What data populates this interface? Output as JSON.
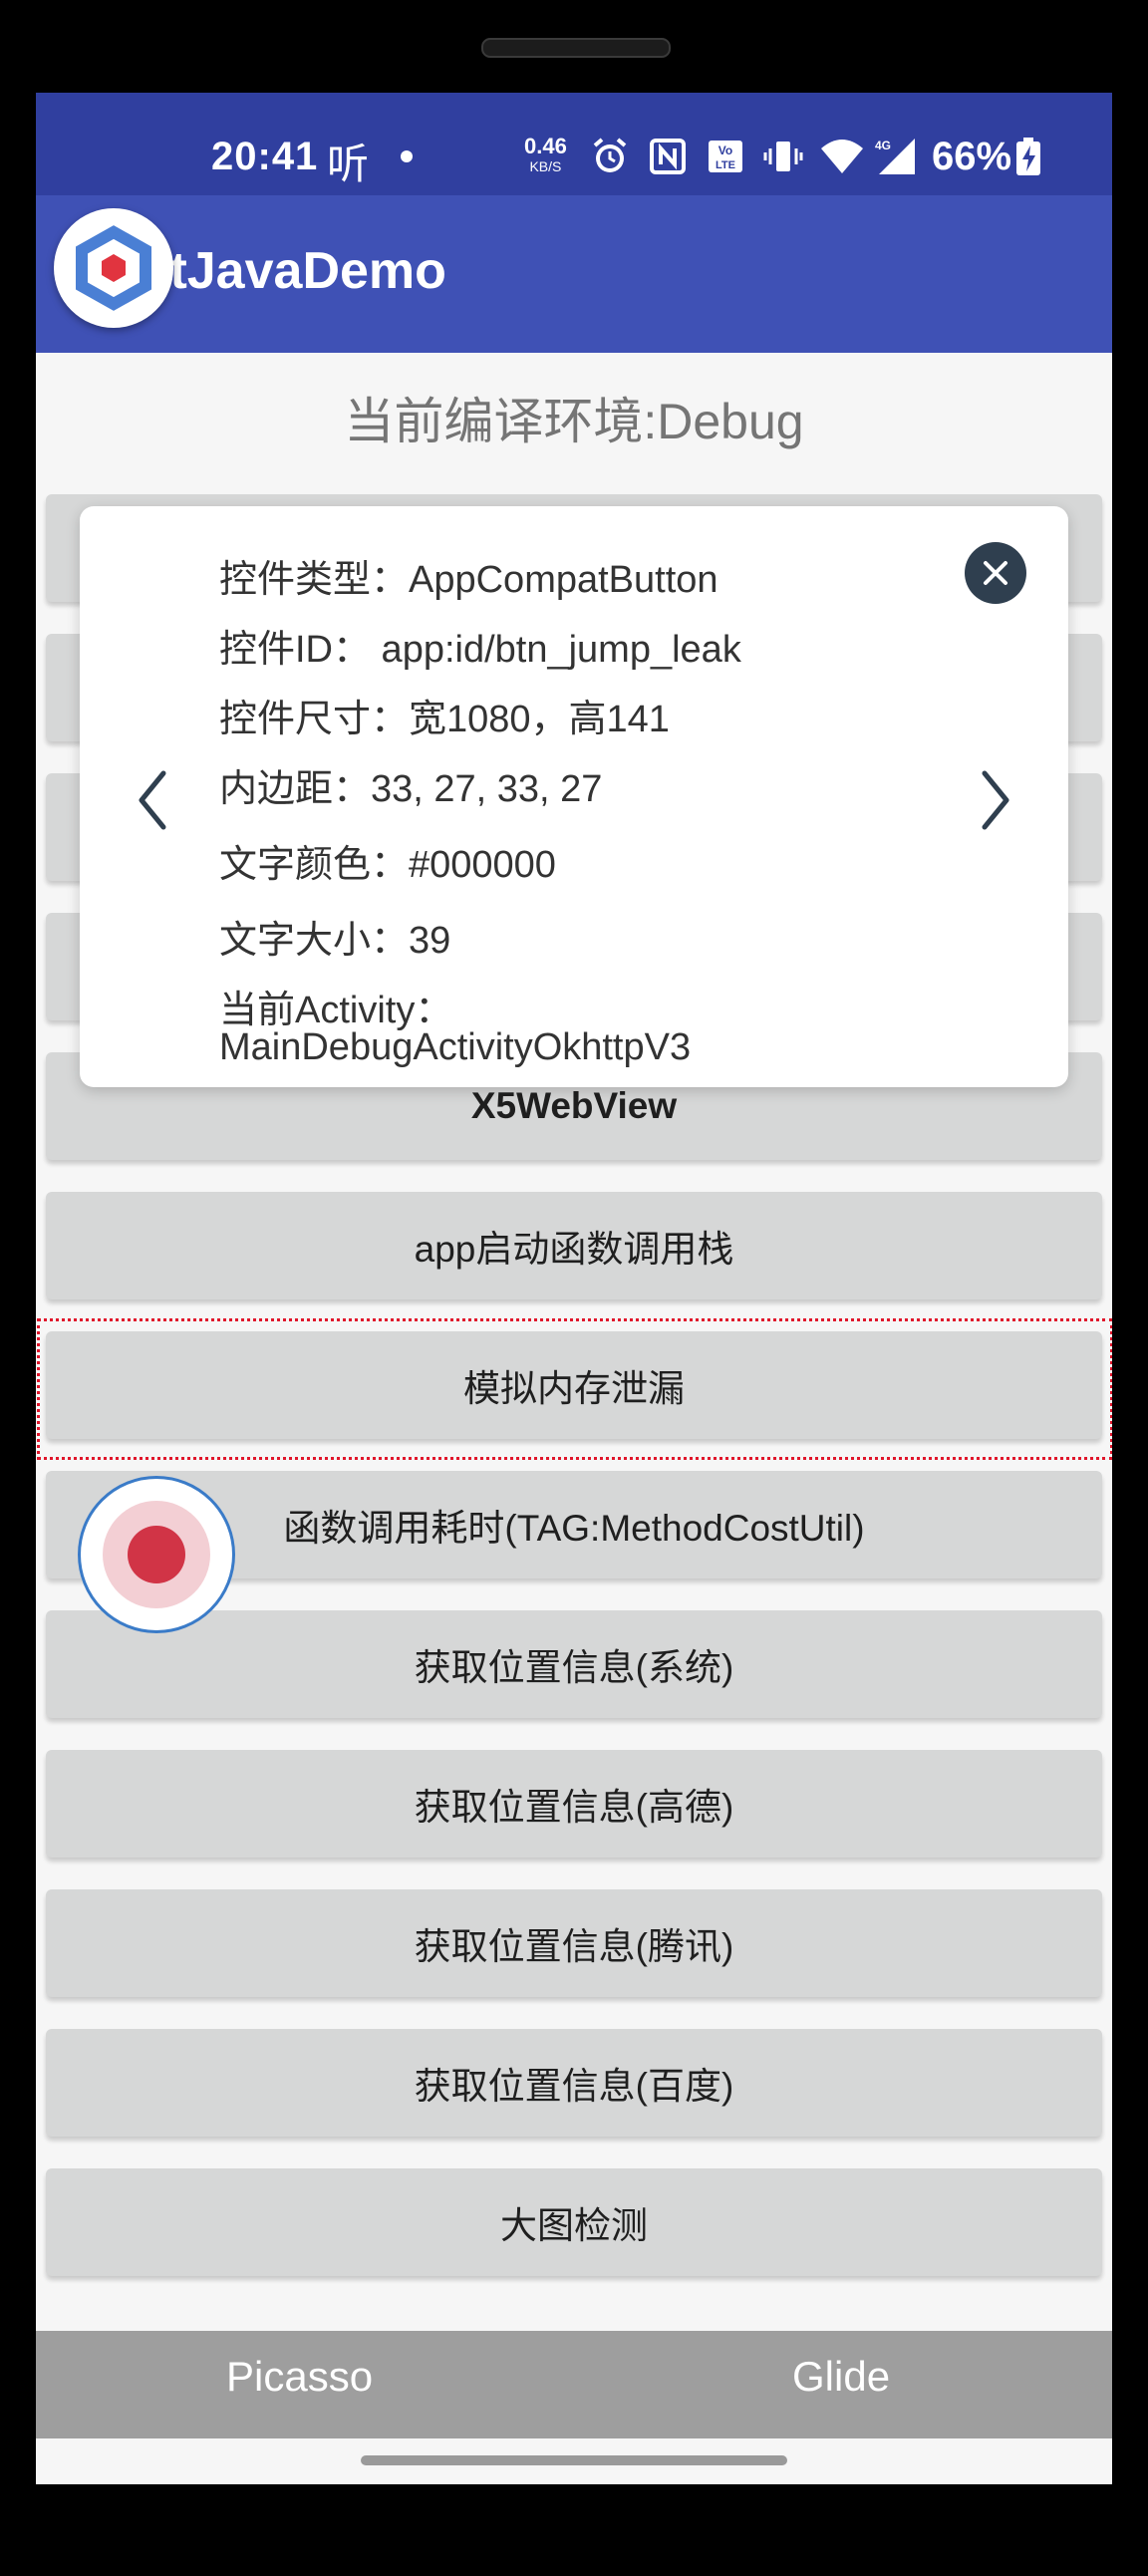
{
  "status_bar": {
    "time": "20:41",
    "listen_icon_text": "听",
    "net_speed_value": "0.46",
    "net_speed_unit": "KB/S",
    "battery_percent": "66%"
  },
  "app_bar": {
    "title": "itJavaDemo"
  },
  "env_label": "当前编译环境:Debug",
  "buttons": [
    "X5WebView",
    "app启动函数调用栈",
    "模拟内存泄漏",
    "函数调用耗时(TAG:MethodCostUtil)",
    "获取位置信息(系统)",
    "获取位置信息(高德)",
    "获取位置信息(腾讯)",
    "获取位置信息(百度)",
    "大图检测"
  ],
  "inspector": {
    "type": "控件类型：AppCompatButton",
    "id": "控件ID： app:id/btn_jump_leak",
    "size": "控件尺寸：宽1080，高141",
    "padding": "内边距：33, 27, 33, 27",
    "text_color": "文字颜色：#000000",
    "text_size": "文字大小：39",
    "activity_label": "当前Activity：",
    "activity_value": "MainDebugActivityOkhttpV3"
  },
  "bottom_tabs": [
    "Picasso",
    "Glide"
  ],
  "colors": {
    "status_bar": "#303f9f",
    "app_bar": "#3f51b5",
    "button_bg": "#d6d7d7",
    "selection_outline": "#e0162b",
    "record_dot": "#d13446",
    "bottom_tabs_bg": "#9e9e9e"
  }
}
